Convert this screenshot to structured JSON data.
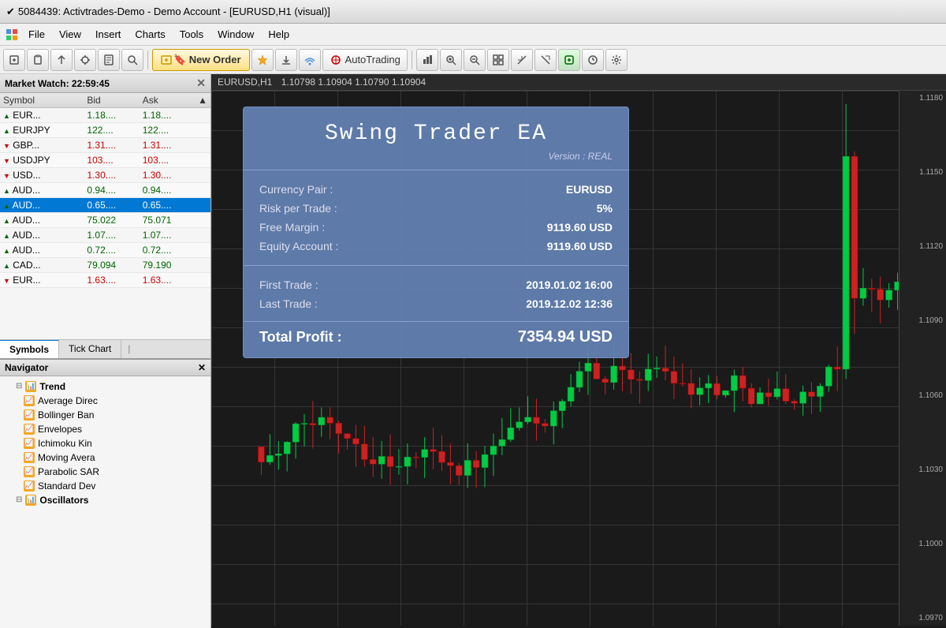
{
  "titleBar": {
    "title": "5084439: Activtrades-Demo - Demo Account - [EURUSD,H1 (visual)]",
    "checkmark": "✔"
  },
  "menuBar": {
    "icon": "🖥",
    "items": [
      "File",
      "View",
      "Insert",
      "Charts",
      "Tools",
      "Window",
      "Help"
    ]
  },
  "toolbar": {
    "newOrderLabel": "🔖 New Order",
    "autoTradingLabel": "AutoTrading",
    "buttons": [
      "+",
      "📋",
      "↕",
      "🔍",
      "📄",
      "🔎"
    ]
  },
  "marketWatch": {
    "title": "Market Watch:",
    "time": "22:59:45",
    "columns": [
      "Symbol",
      "Bid",
      "Ask"
    ],
    "symbols": [
      {
        "name": "EUR...",
        "bid": "1.18....",
        "ask": "1.18....",
        "dir": "up",
        "selected": false
      },
      {
        "name": "EURJPY",
        "bid": "122....",
        "ask": "122....",
        "dir": "up",
        "selected": false
      },
      {
        "name": "GBP...",
        "bid": "1.31....",
        "ask": "1.31....",
        "dir": "down",
        "selected": false
      },
      {
        "name": "USDJPY",
        "bid": "103....",
        "ask": "103....",
        "dir": "down",
        "selected": false
      },
      {
        "name": "USD...",
        "bid": "1.30....",
        "ask": "1.30....",
        "dir": "down",
        "selected": false
      },
      {
        "name": "AUD...",
        "bid": "0.94....",
        "ask": "0.94....",
        "dir": "up",
        "selected": false
      },
      {
        "name": "AUD...",
        "bid": "0.65....",
        "ask": "0.65....",
        "dir": "up",
        "selected": true
      },
      {
        "name": "AUD...",
        "bid": "75.022",
        "ask": "75.071",
        "dir": "up",
        "selected": false
      },
      {
        "name": "AUD...",
        "bid": "1.07....",
        "ask": "1.07....",
        "dir": "up",
        "selected": false
      },
      {
        "name": "AUD...",
        "bid": "0.72....",
        "ask": "0.72....",
        "dir": "up",
        "selected": false
      },
      {
        "name": "CAD...",
        "bid": "79.094",
        "ask": "79.190",
        "dir": "up",
        "selected": false
      },
      {
        "name": "EUR...",
        "bid": "1.63....",
        "ask": "1.63....",
        "dir": "down",
        "selected": false
      }
    ],
    "tabs": [
      "Symbols",
      "Tick Chart",
      "|"
    ]
  },
  "navigator": {
    "title": "Navigator",
    "tree": [
      {
        "label": "Trend",
        "type": "folder",
        "indent": 1
      },
      {
        "label": "Average Direc",
        "type": "item",
        "indent": 2
      },
      {
        "label": "Bollinger Ban",
        "type": "item",
        "indent": 2
      },
      {
        "label": "Envelopes",
        "type": "item",
        "indent": 2
      },
      {
        "label": "Ichimoku Kin",
        "type": "item",
        "indent": 2
      },
      {
        "label": "Moving Avera",
        "type": "item",
        "indent": 2
      },
      {
        "label": "Parabolic SAR",
        "type": "item",
        "indent": 2
      },
      {
        "label": "Standard Dev",
        "type": "item",
        "indent": 2
      },
      {
        "label": "Oscillators",
        "type": "folder",
        "indent": 1
      }
    ]
  },
  "chartHeader": {
    "symbol": "EURUSD,H1",
    "prices": "1.10798 1.10904 1.10790 1.10904"
  },
  "infoCard": {
    "title": "Swing Trader EA",
    "version": "Version : REAL",
    "fields": [
      {
        "label": "Currency Pair :",
        "value": "EURUSD"
      },
      {
        "label": "Risk per Trade :",
        "value": "5%"
      },
      {
        "label": "Free Margin :",
        "value": "9119.60 USD"
      },
      {
        "label": "Equity Account :",
        "value": "9119.60 USD"
      }
    ],
    "trades": [
      {
        "label": "First Trade :",
        "value": "2019.01.02 16:00"
      },
      {
        "label": "Last Trade :",
        "value": "2019.12.02 12:36"
      }
    ],
    "profitLabel": "Total Profit :",
    "profitValue": "7354.94 USD"
  },
  "priceScale": {
    "prices": [
      "1.1180",
      "1.1150",
      "1.1120",
      "1.1090",
      "1.1060",
      "1.1030",
      "1.1000",
      "1.0970"
    ]
  }
}
